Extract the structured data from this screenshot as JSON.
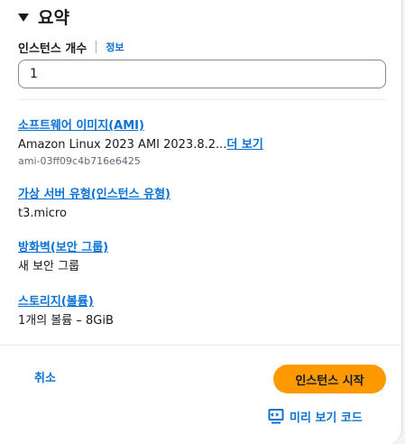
{
  "summary": {
    "title": "요약"
  },
  "instance_count": {
    "label": "인스턴스 개수",
    "info_link": "정보",
    "value": "1"
  },
  "sections": [
    {
      "link": "소프트웨어 이미지(AMI)",
      "value": "Amazon Linux 2023 AMI 2023.8.2...",
      "more_link": "더 보기",
      "sub": "ami-03ff09c4b716e6425"
    },
    {
      "link": "가상 서버 유형(인스턴스 유형)",
      "value": "t3.micro"
    },
    {
      "link": "방화벽(보안 그룹)",
      "value": "새 보안 그룹"
    },
    {
      "link": "스토리지(볼륨)",
      "value": "1개의 볼륨 – 8GiB"
    }
  ],
  "actions": {
    "cancel": "취소",
    "launch": "인스턴스 시작",
    "preview_code": "미리 보기 코드"
  },
  "colors": {
    "link": "#0972d3",
    "primary_button": "#ff9900",
    "text": "#16191f"
  },
  "icons": {
    "collapse": "caret-down-icon",
    "preview": "code-preview-icon"
  }
}
